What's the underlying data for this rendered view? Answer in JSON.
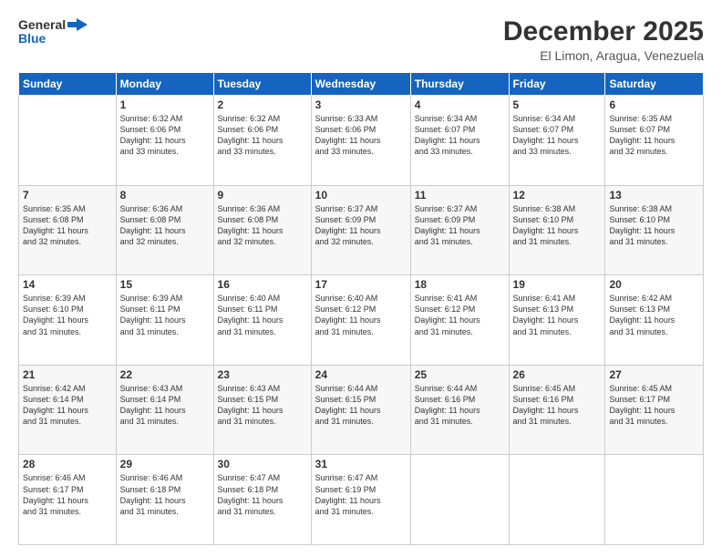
{
  "header": {
    "logo_line1": "General",
    "logo_line2": "Blue",
    "month": "December 2025",
    "location": "El Limon, Aragua, Venezuela"
  },
  "weekdays": [
    "Sunday",
    "Monday",
    "Tuesday",
    "Wednesday",
    "Thursday",
    "Friday",
    "Saturday"
  ],
  "weeks": [
    [
      {
        "day": "",
        "info": ""
      },
      {
        "day": "1",
        "info": "Sunrise: 6:32 AM\nSunset: 6:06 PM\nDaylight: 11 hours\nand 33 minutes."
      },
      {
        "day": "2",
        "info": "Sunrise: 6:32 AM\nSunset: 6:06 PM\nDaylight: 11 hours\nand 33 minutes."
      },
      {
        "day": "3",
        "info": "Sunrise: 6:33 AM\nSunset: 6:06 PM\nDaylight: 11 hours\nand 33 minutes."
      },
      {
        "day": "4",
        "info": "Sunrise: 6:34 AM\nSunset: 6:07 PM\nDaylight: 11 hours\nand 33 minutes."
      },
      {
        "day": "5",
        "info": "Sunrise: 6:34 AM\nSunset: 6:07 PM\nDaylight: 11 hours\nand 33 minutes."
      },
      {
        "day": "6",
        "info": "Sunrise: 6:35 AM\nSunset: 6:07 PM\nDaylight: 11 hours\nand 32 minutes."
      }
    ],
    [
      {
        "day": "7",
        "info": "Sunrise: 6:35 AM\nSunset: 6:08 PM\nDaylight: 11 hours\nand 32 minutes."
      },
      {
        "day": "8",
        "info": "Sunrise: 6:36 AM\nSunset: 6:08 PM\nDaylight: 11 hours\nand 32 minutes."
      },
      {
        "day": "9",
        "info": "Sunrise: 6:36 AM\nSunset: 6:08 PM\nDaylight: 11 hours\nand 32 minutes."
      },
      {
        "day": "10",
        "info": "Sunrise: 6:37 AM\nSunset: 6:09 PM\nDaylight: 11 hours\nand 32 minutes."
      },
      {
        "day": "11",
        "info": "Sunrise: 6:37 AM\nSunset: 6:09 PM\nDaylight: 11 hours\nand 31 minutes."
      },
      {
        "day": "12",
        "info": "Sunrise: 6:38 AM\nSunset: 6:10 PM\nDaylight: 11 hours\nand 31 minutes."
      },
      {
        "day": "13",
        "info": "Sunrise: 6:38 AM\nSunset: 6:10 PM\nDaylight: 11 hours\nand 31 minutes."
      }
    ],
    [
      {
        "day": "14",
        "info": "Sunrise: 6:39 AM\nSunset: 6:10 PM\nDaylight: 11 hours\nand 31 minutes."
      },
      {
        "day": "15",
        "info": "Sunrise: 6:39 AM\nSunset: 6:11 PM\nDaylight: 11 hours\nand 31 minutes."
      },
      {
        "day": "16",
        "info": "Sunrise: 6:40 AM\nSunset: 6:11 PM\nDaylight: 11 hours\nand 31 minutes."
      },
      {
        "day": "17",
        "info": "Sunrise: 6:40 AM\nSunset: 6:12 PM\nDaylight: 11 hours\nand 31 minutes."
      },
      {
        "day": "18",
        "info": "Sunrise: 6:41 AM\nSunset: 6:12 PM\nDaylight: 11 hours\nand 31 minutes."
      },
      {
        "day": "19",
        "info": "Sunrise: 6:41 AM\nSunset: 6:13 PM\nDaylight: 11 hours\nand 31 minutes."
      },
      {
        "day": "20",
        "info": "Sunrise: 6:42 AM\nSunset: 6:13 PM\nDaylight: 11 hours\nand 31 minutes."
      }
    ],
    [
      {
        "day": "21",
        "info": "Sunrise: 6:42 AM\nSunset: 6:14 PM\nDaylight: 11 hours\nand 31 minutes."
      },
      {
        "day": "22",
        "info": "Sunrise: 6:43 AM\nSunset: 6:14 PM\nDaylight: 11 hours\nand 31 minutes."
      },
      {
        "day": "23",
        "info": "Sunrise: 6:43 AM\nSunset: 6:15 PM\nDaylight: 11 hours\nand 31 minutes."
      },
      {
        "day": "24",
        "info": "Sunrise: 6:44 AM\nSunset: 6:15 PM\nDaylight: 11 hours\nand 31 minutes."
      },
      {
        "day": "25",
        "info": "Sunrise: 6:44 AM\nSunset: 6:16 PM\nDaylight: 11 hours\nand 31 minutes."
      },
      {
        "day": "26",
        "info": "Sunrise: 6:45 AM\nSunset: 6:16 PM\nDaylight: 11 hours\nand 31 minutes."
      },
      {
        "day": "27",
        "info": "Sunrise: 6:45 AM\nSunset: 6:17 PM\nDaylight: 11 hours\nand 31 minutes."
      }
    ],
    [
      {
        "day": "28",
        "info": "Sunrise: 6:46 AM\nSunset: 6:17 PM\nDaylight: 11 hours\nand 31 minutes."
      },
      {
        "day": "29",
        "info": "Sunrise: 6:46 AM\nSunset: 6:18 PM\nDaylight: 11 hours\nand 31 minutes."
      },
      {
        "day": "30",
        "info": "Sunrise: 6:47 AM\nSunset: 6:18 PM\nDaylight: 11 hours\nand 31 minutes."
      },
      {
        "day": "31",
        "info": "Sunrise: 6:47 AM\nSunset: 6:19 PM\nDaylight: 11 hours\nand 31 minutes."
      },
      {
        "day": "",
        "info": ""
      },
      {
        "day": "",
        "info": ""
      },
      {
        "day": "",
        "info": ""
      }
    ]
  ]
}
